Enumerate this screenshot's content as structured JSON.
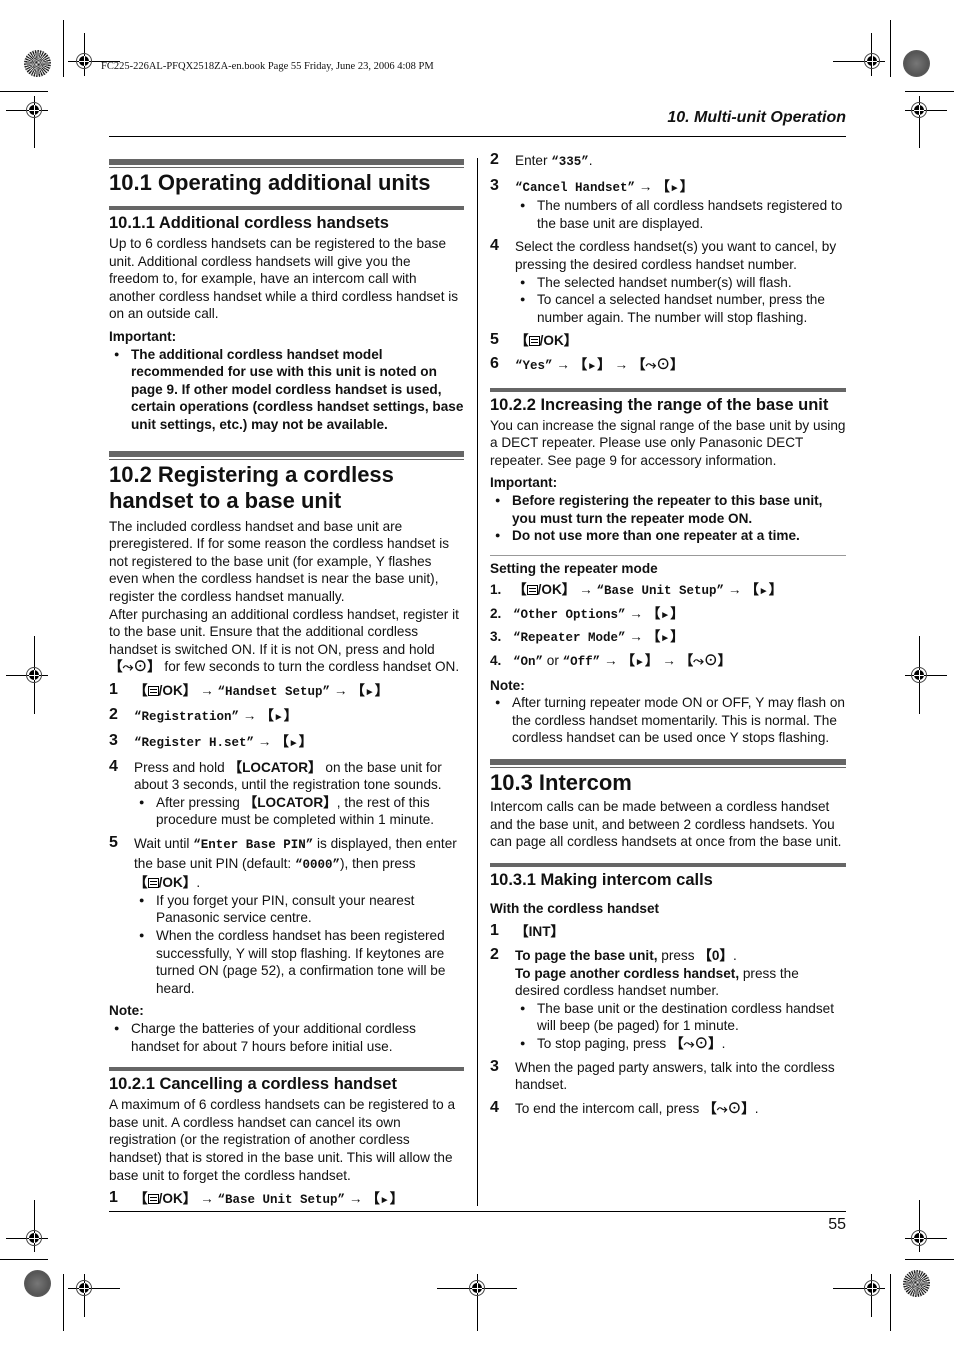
{
  "print_header": "FC225-226AL-PFQX2518ZA-en.book  Page 55  Friday, June 23, 2006  4:08 PM",
  "running_header": "10. Multi-unit Operation",
  "page_number": "55",
  "icons": {
    "ok_key": "menu-ok-icon",
    "right_key": "►",
    "off_key": "⤳⊙",
    "antenna": "Υ"
  },
  "s101": {
    "title": "10.1 Operating additional units",
    "s1011_title": "10.1.1 Additional cordless handsets",
    "s1011_body": "Up to 6 cordless handsets can be registered to the base unit. Additional cordless handsets will give you the freedom to, for example, have an intercom call with another cordless handset while a third cordless handset is on an outside call.",
    "important_label": "Important:",
    "important_items": [
      "The additional cordless handset model recommended for use with this unit is noted on page 9. If other model cordless handset is used, certain operations (cordless handset settings, base unit settings, etc.) may not be available."
    ]
  },
  "s102": {
    "title": "10.2 Registering a cordless handset to a base unit",
    "body1_a": "The included cordless handset and base unit are preregistered. If for some reason the cordless handset is not registered to the base unit (for example, ",
    "body1_b": " flashes even when the cordless handset is near the base unit), register the cordless handset manually.",
    "body2_a": "After purchasing an additional cordless handset, register it to the base unit. Ensure that the additional cordless handset is switched ON. If it is not ON, press and hold ",
    "body2_b": " for few seconds to turn the cordless handset ON.",
    "steps": {
      "s1_key": "/OK",
      "s1_menu": "“Handset Setup”",
      "s2_menu": "“Registration”",
      "s3_menu": "“Register H.set”",
      "s4_a": "Press and hold ",
      "s4_key": "LOCATOR",
      "s4_b": " on the base unit for about 3 seconds, until the registration tone sounds.",
      "s4_bullet_a": "After pressing ",
      "s4_bullet_b": ", the rest of this procedure must be completed within 1 minute.",
      "s5_a": "Wait until ",
      "s5_display": "“Enter Base PIN”",
      "s5_b": " is displayed, then enter the base unit PIN (default: ",
      "s5_pin": "“0000”",
      "s5_c": "), then press ",
      "s5_bullet1": "If you forget your PIN, consult your nearest Panasonic service centre.",
      "s5_bullet2_a": "When the cordless handset has been registered successfully, ",
      "s5_bullet2_b": " will stop flashing. If keytones are turned ON (page 52), a confirmation tone will be heard."
    },
    "note_label": "Note:",
    "note_items": [
      "Charge the batteries of your additional cordless handset for about 7 hours before initial use."
    ]
  },
  "s1021": {
    "title": "10.2.1 Cancelling a cordless handset",
    "body": "A maximum of 6 cordless handsets can be registered to a base unit. A cordless handset can cancel its own registration (or the registration of another cordless handset) that is stored in the base unit. This will allow the base unit to forget the cordless handset.",
    "s1_menu": "“Base Unit Setup”",
    "s2_a": "Enter ",
    "s2_code": "“335”",
    "s2_b": ".",
    "s3_menu": "“Cancel Handset”",
    "s3_bullet": "The numbers of all cordless handsets registered to the base unit are displayed.",
    "s4_text": "Select the cordless handset(s) you want to cancel, by pressing the desired cordless handset number.",
    "s4_bullets": [
      "The selected handset number(s) will flash.",
      "To cancel a selected handset number, press the number again. The number will stop flashing."
    ],
    "s6_menu": "“Yes”"
  },
  "s1022": {
    "title": "10.2.2 Increasing the range of the base unit",
    "body": "You can increase the signal range of the base unit by using a DECT repeater. Please use only Panasonic DECT repeater. See page 9 for accessory information.",
    "important_label": "Important:",
    "important_items": [
      "Before registering the repeater to this base unit, you must turn the repeater mode ON.",
      "Do not use more than one repeater at a time."
    ],
    "setting_label": "Setting the repeater mode",
    "r1_menu": "“Base Unit Setup”",
    "r2_menu": "“Other Options”",
    "r3_menu": "“Repeater Mode”",
    "r4_on": "“On”",
    "r4_or": " or ",
    "r4_off": "“Off”",
    "note_label": "Note:",
    "note_a": "After turning repeater mode ON or OFF, ",
    "note_b": " may flash on the cordless handset momentarily. This is normal. The cordless handset can be used once ",
    "note_c": " stops flashing."
  },
  "s103": {
    "title": "10.3 Intercom",
    "body": "Intercom calls can be made between a cordless handset and the base unit, and between 2 cordless handsets. You can page all cordless handsets at once from the base unit.",
    "s1031_title": "10.3.1 Making intercom calls",
    "with_label": "With the cordless handset",
    "s1_key": "INT",
    "s2_bold1": "To page the base unit,",
    "s2_text1": " press ",
    "s2_key": "0",
    "s2_bold2": "To page another cordless handset,",
    "s2_text2": " press the desired cordless handset number.",
    "s2_bullet1": "The base unit or the destination cordless handset will beep (be paged) for 1 minute.",
    "s2_bullet2": "To stop paging, press ",
    "s3_text": "When the paged party answers, talk into the cordless handset.",
    "s4_text": "To end the intercom call, press "
  }
}
